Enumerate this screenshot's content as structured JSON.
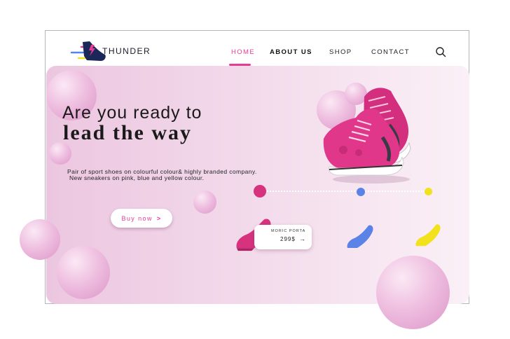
{
  "brand": {
    "name": "THUNDER",
    "colors": {
      "pink": "#e73c93",
      "blue": "#5b82e6",
      "yellow": "#f2e21e",
      "navy": "#1b2659"
    }
  },
  "nav": {
    "items": [
      {
        "label": "HOME",
        "active": true
      },
      {
        "label": "ABOUT US",
        "active": false
      },
      {
        "label": "SHOP",
        "active": false
      },
      {
        "label": "CONTACT",
        "active": false
      }
    ],
    "search_icon": "search-icon"
  },
  "hero": {
    "title_line1": "Are you ready to",
    "title_line2": "lead the way",
    "description_line1": "Pair of sport shoes on colourful colour& highly branded company.",
    "description_line2": "New sneakers on pink, blue and yellow colour.",
    "buy_button": {
      "label": "Buy now",
      "arrow": ">"
    }
  },
  "color_selector": {
    "options": [
      "pink",
      "blue",
      "yellow"
    ],
    "selected": "pink"
  },
  "product_card": {
    "name": "MORIC PORTA",
    "price": "299$",
    "arrow": "→"
  }
}
